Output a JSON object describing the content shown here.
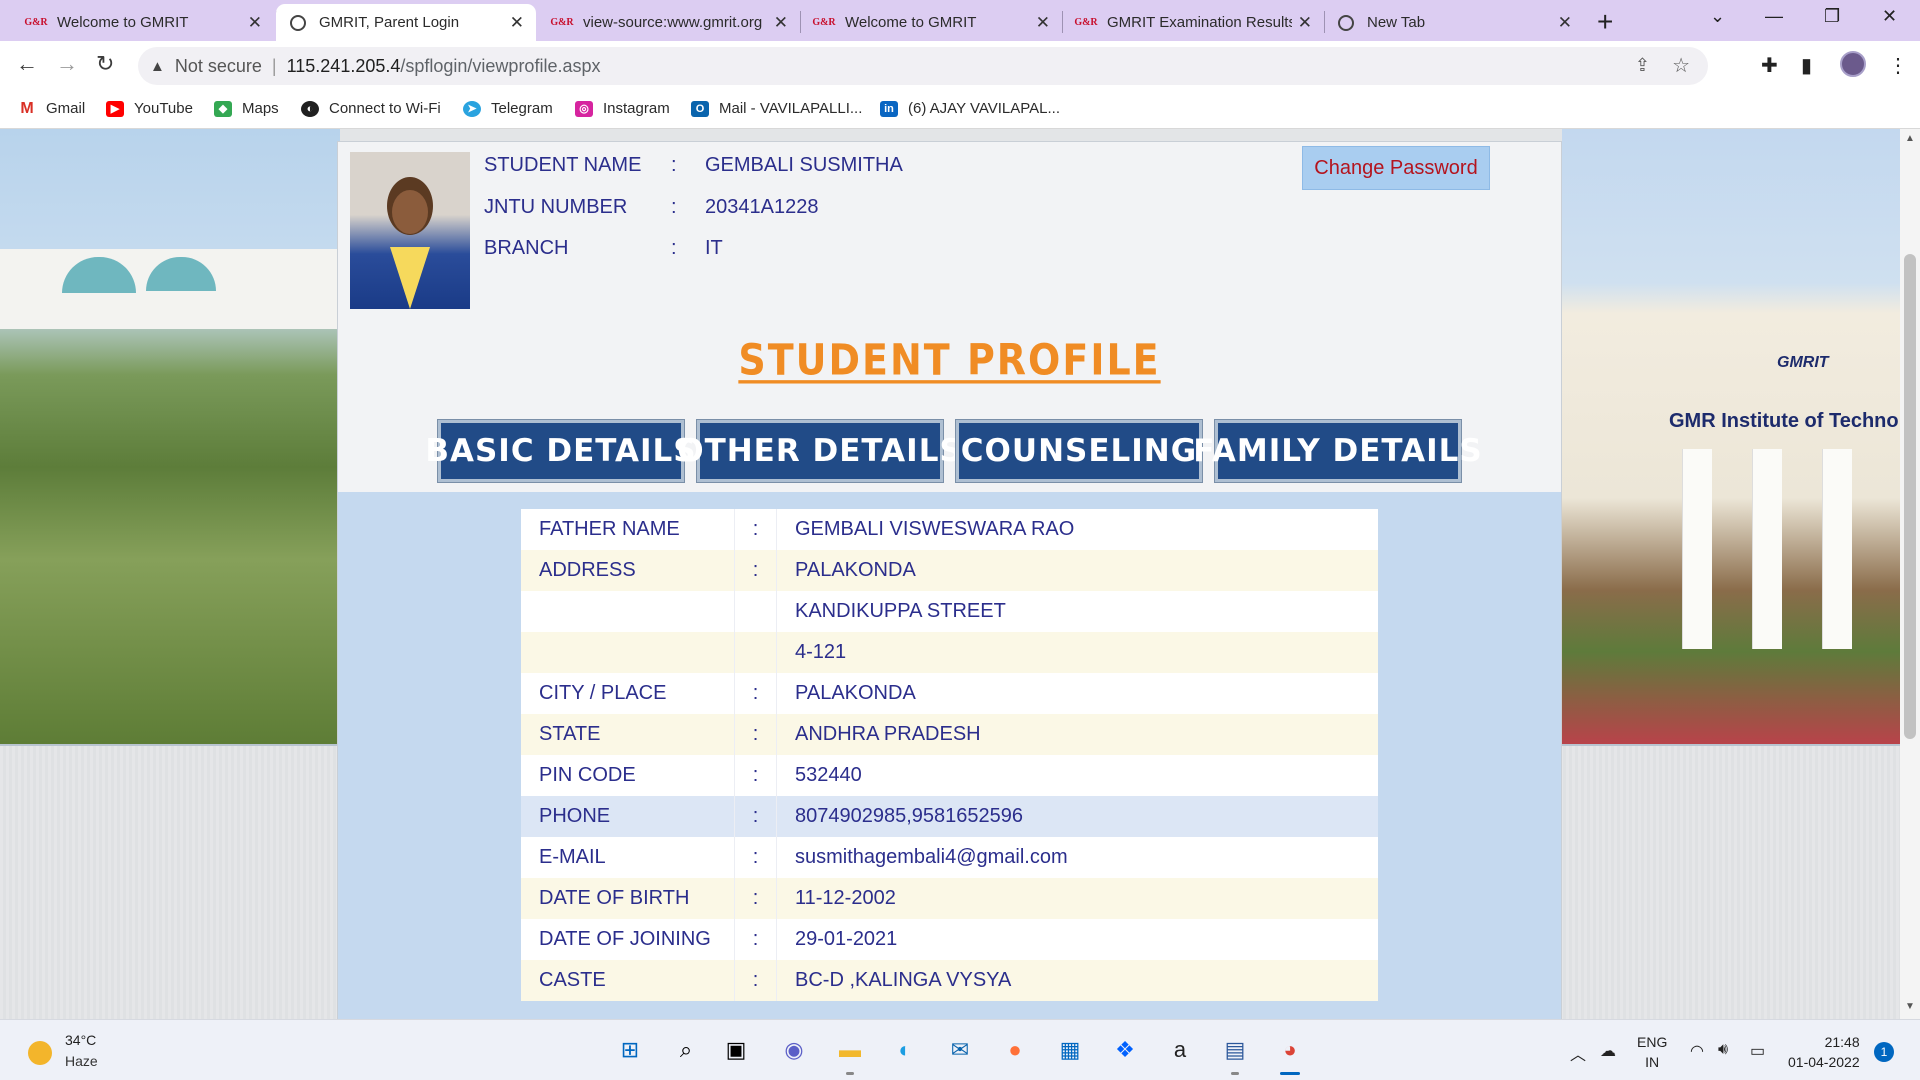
{
  "browser": {
    "tabs": [
      {
        "title": "Welcome to GMRIT",
        "favicon": "gmr-logo",
        "active": false
      },
      {
        "title": "GMRIT, Parent Login",
        "favicon": "globe-icon",
        "active": true
      },
      {
        "title": "view-source:www.gmrit.org",
        "favicon": "gmr-logo",
        "active": false
      },
      {
        "title": "Welcome to GMRIT",
        "favicon": "gmr-logo",
        "active": false
      },
      {
        "title": "GMRIT Examination Results",
        "favicon": "gmr-logo",
        "active": false
      },
      {
        "title": "New Tab",
        "favicon": "chrome-icon",
        "active": false
      }
    ],
    "security_label": "Not secure",
    "url_host": "115.241.205.4",
    "url_path": "/spflogin/viewprofile.aspx",
    "bookmarks": [
      {
        "label": "Gmail",
        "icon": "gmail-icon"
      },
      {
        "label": "YouTube",
        "icon": "youtube-icon"
      },
      {
        "label": "Maps",
        "icon": "maps-icon"
      },
      {
        "label": "Connect to Wi-Fi",
        "icon": "wifi-icon"
      },
      {
        "label": "Telegram",
        "icon": "telegram-icon"
      },
      {
        "label": "Instagram",
        "icon": "instagram-icon"
      },
      {
        "label": "Mail - VAVILAPALLI...",
        "icon": "outlook-icon"
      },
      {
        "label": "(6) AJAY VAVILAPAL...",
        "icon": "linkedin-icon"
      }
    ]
  },
  "banner": {
    "logo_text": "GMRIT",
    "institute_text": "GMR Institute of Techno"
  },
  "student": {
    "name_label": "STUDENT NAME",
    "name": "GEMBALI SUSMITHA",
    "jntu_label": "JNTU NUMBER",
    "jntu": "20341A1228",
    "branch_label": "BRANCH",
    "branch": "IT",
    "colon": ":"
  },
  "actions": {
    "change_password": "Change Password"
  },
  "profile_title": "STUDENT PROFILE",
  "nav_buttons": [
    "BASIC DETAILS",
    "OTHER DETAILS",
    "COUNSELING",
    "FAMILY DETAILS"
  ],
  "details": [
    {
      "label": "FATHER NAME",
      "sep": ":",
      "value": "GEMBALI VISWESWARA RAO"
    },
    {
      "label": "ADDRESS",
      "sep": ":",
      "value": "PALAKONDA"
    },
    {
      "label": "",
      "sep": "",
      "value": "KANDIKUPPA STREET"
    },
    {
      "label": "",
      "sep": "",
      "value": "4-121"
    },
    {
      "label": "CITY / PLACE",
      "sep": ":",
      "value": "PALAKONDA"
    },
    {
      "label": "STATE",
      "sep": ":",
      "value": "ANDHRA PRADESH"
    },
    {
      "label": "PIN CODE",
      "sep": ":",
      "value": "532440"
    },
    {
      "label": "PHONE",
      "sep": ":",
      "value": "8074902985,9581652596"
    },
    {
      "label": "E-MAIL",
      "sep": ":",
      "value": "susmithagembali4@gmail.com"
    },
    {
      "label": "DATE OF BIRTH",
      "sep": ":",
      "value": "11-12-2002"
    },
    {
      "label": "DATE OF JOINING",
      "sep": ":",
      "value": "29-01-2021"
    },
    {
      "label": "CASTE",
      "sep": ":",
      "value": "BC-D ,KALINGA VYSYA"
    }
  ],
  "taskbar": {
    "weather_temp": "34°C",
    "weather_desc": "Haze",
    "lang_top": "ENG",
    "lang_bottom": "IN",
    "time": "21:48",
    "date": "01-04-2022",
    "notification_count": "1"
  },
  "colors": {
    "accent_title": "#f08c24",
    "nav_button_bg": "#214b87",
    "label_text": "#2b2e8c",
    "change_password_text": "#b4141e"
  }
}
